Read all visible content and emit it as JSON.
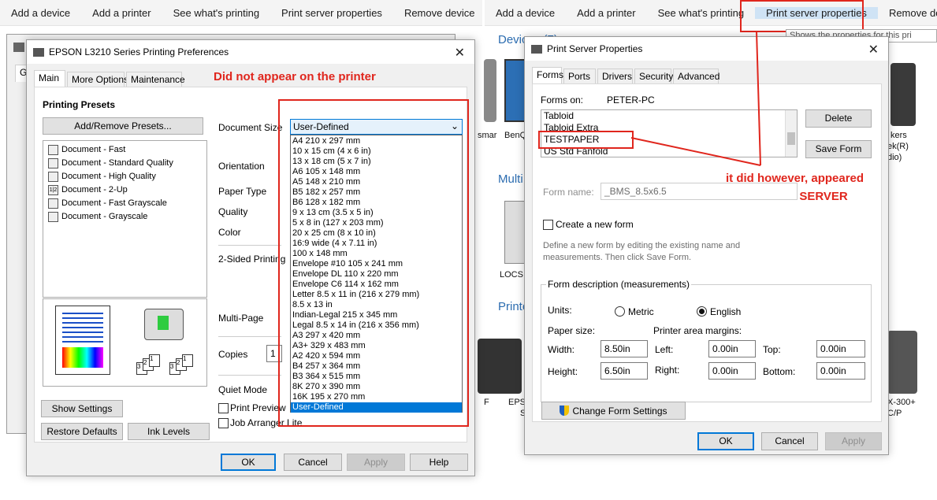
{
  "left_cmdbar": [
    "Add a device",
    "Add a printer",
    "See what's printing",
    "Print server properties",
    "Remove device"
  ],
  "right_cmdbar": [
    "Add a device",
    "Add a printer",
    "See what's printing",
    "Print server properties",
    "Remove dev"
  ],
  "bg_tooltip": "Shows the properties for this pri",
  "bg_sections": {
    "devices": "Devices (7)",
    "multi": "Multi",
    "printers": "Printe"
  },
  "bg_right_text": [
    "smar",
    "BenQ",
    "LOCSI",
    "F",
    "EPSO",
    "S",
    "kers",
    "ek(R)",
    "dio)",
    "X-300+",
    "C/P"
  ],
  "behind_window_tab": "Ge",
  "epson": {
    "title": "EPSON L3210 Series Printing Preferences",
    "tabs": [
      "Main",
      "More Options",
      "Maintenance"
    ],
    "annotation": "Did not appear on the printer",
    "presets_heading": "Printing Presets",
    "add_remove_btn": "Add/Remove Presets...",
    "presets": [
      {
        "label": "Document - Fast",
        "icon": "document-icon"
      },
      {
        "label": "Document - Standard Quality",
        "icon": "document-icon"
      },
      {
        "label": "Document - High Quality",
        "icon": "document-icon"
      },
      {
        "label": "Document - 2-Up",
        "icon": "two-up-icon",
        "glyph": "1|2"
      },
      {
        "label": "Document - Fast Grayscale",
        "icon": "document-icon"
      },
      {
        "label": "Document - Grayscale",
        "icon": "document-icon"
      }
    ],
    "labels": {
      "document_size": "Document Size",
      "orientation": "Orientation",
      "paper_type": "Paper Type",
      "quality": "Quality",
      "color": "Color",
      "two_sided": "2-Sided Printing",
      "multi_page": "Multi-Page",
      "copies": "Copies",
      "quiet_mode": "Quiet Mode",
      "print_preview": "Print Preview",
      "job_arranger": "Job Arranger Lite"
    },
    "copies_value": "1",
    "page_count_glyphs": [
      "1",
      "2",
      "3"
    ],
    "dropdown_selected": "User-Defined",
    "dropdown_options": [
      "A4 210 x 297 mm",
      "10 x 15 cm (4 x 6 in)",
      "13 x 18 cm (5 x 7 in)",
      "A6 105 x 148 mm",
      "A5 148 x 210 mm",
      "B5 182 x 257 mm",
      "B6 128 x 182 mm",
      "9 x 13 cm (3.5 x 5 in)",
      "5 x 8 in (127 x 203 mm)",
      "20 x 25 cm (8 x 10 in)",
      "16:9 wide (4 x 7.11 in)",
      "100 x 148 mm",
      "Envelope #10 105 x 241 mm",
      "Envelope DL 110 x 220 mm",
      "Envelope C6 114 x 162 mm",
      "Letter 8.5 x 11 in (216 x 279 mm)",
      "8.5 x 13 in",
      "Indian-Legal 215 x 345 mm",
      "Legal 8.5 x 14 in (216 x 356 mm)",
      "A3 297 x 420 mm",
      "A3+ 329 x 483 mm",
      "A2 420 x 594 mm",
      "B4 257 x 364 mm",
      "B3 364 x 515 mm",
      "8K 270 x 390 mm",
      "16K 195 x 270 mm",
      "User-Defined"
    ],
    "buttons": {
      "show_settings": "Show Settings",
      "restore_defaults": "Restore Defaults",
      "ink_levels": "Ink Levels",
      "ok": "OK",
      "cancel": "Cancel",
      "apply": "Apply",
      "help": "Help"
    }
  },
  "psp": {
    "title": "Print Server Properties",
    "tabs": [
      "Forms",
      "Ports",
      "Drivers",
      "Security",
      "Advanced"
    ],
    "forms_on_label": "Forms on:",
    "forms_on_value": "PETER-PC",
    "forms_list": [
      "Tabloid",
      "Tabloid Extra",
      "TESTPAPER",
      "US Std Fanfold"
    ],
    "delete_btn": "Delete",
    "save_form_btn": "Save Form",
    "annotation": "it did however, appeared in the PRINT SERVER",
    "form_name_label": "Form name:",
    "form_name_value": "_BMS_8.5x6.5",
    "create_new_form": "Create a new form",
    "define_text": "Define a new form by editing the existing name and measurements. Then click Save Form.",
    "form_desc_legend": "Form description (measurements)",
    "units_label": "Units:",
    "metric": "Metric",
    "english": "English",
    "paper_size_label": "Paper size:",
    "margins_label": "Printer area margins:",
    "width_label": "Width:",
    "width_value": "8.50in",
    "height_label": "Height:",
    "height_value": "6.50in",
    "left_label": "Left:",
    "left_value": "0.00in",
    "right_label": "Right:",
    "right_value": "0.00in",
    "top_label": "Top:",
    "top_value": "0.00in",
    "bottom_label": "Bottom:",
    "bottom_value": "0.00in",
    "change_form_btn": "Change Form Settings",
    "ok": "OK",
    "cancel": "Cancel",
    "apply": "Apply"
  },
  "colors": {
    "annotation_red": "#e0261d",
    "selection_blue": "#0078d7",
    "section_blue": "#2b6cb0"
  }
}
